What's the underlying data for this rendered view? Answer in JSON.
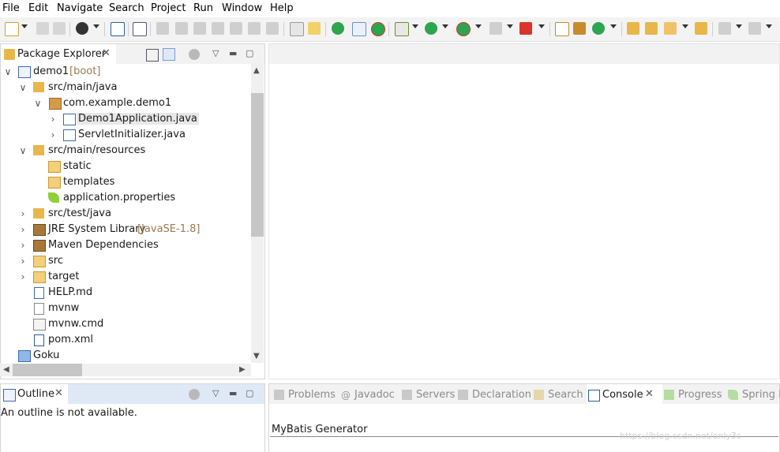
{
  "menu": [
    "File",
    "Edit",
    "Navigate",
    "Search",
    "Project",
    "Run",
    "Window",
    "Help"
  ],
  "colors": {
    "accent_green": "#2da44e",
    "folder_yellow": "#e8b64a",
    "run_red": "#d9332b",
    "java_blue": "#3c6bb0"
  },
  "package_explorer": {
    "title": "Package Explorer",
    "tree": [
      {
        "name": "demo1",
        "decoration": "[boot]",
        "icon": "project-icon"
      },
      {
        "name": "src/main/java",
        "icon": "source-folder-icon"
      },
      {
        "name": "com.example.demo1",
        "icon": "package-icon"
      },
      {
        "name": "Demo1Application.java",
        "icon": "java-file-icon"
      },
      {
        "name": "ServletInitializer.java",
        "icon": "java-file-icon"
      },
      {
        "name": "src/main/resources",
        "icon": "source-folder-icon"
      },
      {
        "name": "static",
        "icon": "folder-icon"
      },
      {
        "name": "templates",
        "icon": "folder-icon"
      },
      {
        "name": "application.properties",
        "icon": "properties-leaf-icon"
      },
      {
        "name": "src/test/java",
        "icon": "source-folder-icon"
      },
      {
        "name": "JRE System Library",
        "decoration": "[JavaSE-1.8]",
        "icon": "library-icon"
      },
      {
        "name": "Maven Dependencies",
        "icon": "library-icon"
      },
      {
        "name": "src",
        "icon": "folder-icon"
      },
      {
        "name": "target",
        "icon": "folder-icon"
      },
      {
        "name": "HELP.md",
        "icon": "markdown-file-icon"
      },
      {
        "name": "mvnw",
        "icon": "text-file-icon"
      },
      {
        "name": "mvnw.cmd",
        "icon": "cmd-file-icon"
      },
      {
        "name": "pom.xml",
        "icon": "maven-pom-icon"
      },
      {
        "name": "Goku",
        "icon": "project-folder-icon"
      }
    ]
  },
  "outline": {
    "title": "Outline",
    "message": "An outline is not available."
  },
  "bottom_tabs": [
    "Problems",
    "Javadoc",
    "Servers",
    "Declaration",
    "Search",
    "Console",
    "Progress",
    "Spring B"
  ],
  "console": {
    "content_title": "MyBatis Generator"
  },
  "watermark": "https://blog.csdn.net/only3c"
}
